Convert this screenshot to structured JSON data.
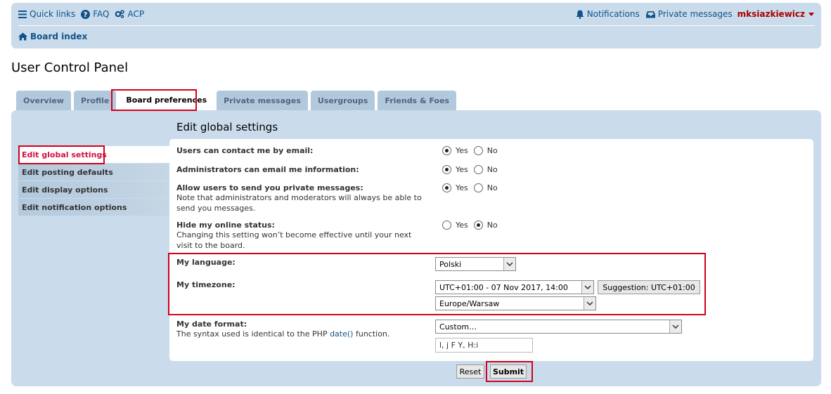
{
  "navbar": {
    "quick_links": "Quick links",
    "faq": "FAQ",
    "acp": "ACP",
    "notifications": "Notifications",
    "private_messages": "Private messages",
    "username": "mksiazkiewicz",
    "board_index": "Board index"
  },
  "page_title": "User Control Panel",
  "tabs": [
    {
      "label": "Overview",
      "active": false
    },
    {
      "label": "Profile",
      "active": false
    },
    {
      "label": "Board preferences",
      "active": true
    },
    {
      "label": "Private messages",
      "active": false
    },
    {
      "label": "Usergroups",
      "active": false
    },
    {
      "label": "Friends & Foes",
      "active": false
    }
  ],
  "sidebar": {
    "items": [
      {
        "label": "Edit global settings",
        "active": true
      },
      {
        "label": "Edit posting defaults",
        "active": false
      },
      {
        "label": "Edit display options",
        "active": false
      },
      {
        "label": "Edit notification options",
        "active": false
      }
    ]
  },
  "section_title": "Edit global settings",
  "settings": {
    "contact_email": {
      "label": "Users can contact me by email:",
      "yes": "Yes",
      "no": "No",
      "value": "Yes"
    },
    "admin_email": {
      "label": "Administrators can email me information:",
      "yes": "Yes",
      "no": "No",
      "value": "Yes"
    },
    "allow_pm": {
      "label": "Allow users to send you private messages:",
      "explain": "Note that administrators and moderators will always be able to send you messages.",
      "yes": "Yes",
      "no": "No",
      "value": "Yes"
    },
    "hide_online": {
      "label": "Hide my online status:",
      "explain": "Changing this setting won’t become effective until your next visit to the board.",
      "yes": "Yes",
      "no": "No",
      "value": "No"
    },
    "language": {
      "label": "My language:",
      "value": "Polski"
    },
    "timezone": {
      "label": "My timezone:",
      "date_value": "UTC+01:00 - 07 Nov 2017, 14:00",
      "suggestion_button": "Suggestion: UTC+01:00",
      "zone_value": "Europe/Warsaw"
    },
    "date_format": {
      "label": "My date format:",
      "explain_prefix": "The syntax used is identical to the PHP",
      "explain_link": "date()",
      "explain_suffix": "function.",
      "select_value": "Custom…",
      "custom_value": "l, j F Y, H:i"
    }
  },
  "buttons": {
    "reset": "Reset",
    "submit": "Submit"
  },
  "colors": {
    "accent": "#105289",
    "highlight": "#d0021b",
    "username": "#aa0000",
    "panel_bg": "#cadceb"
  }
}
